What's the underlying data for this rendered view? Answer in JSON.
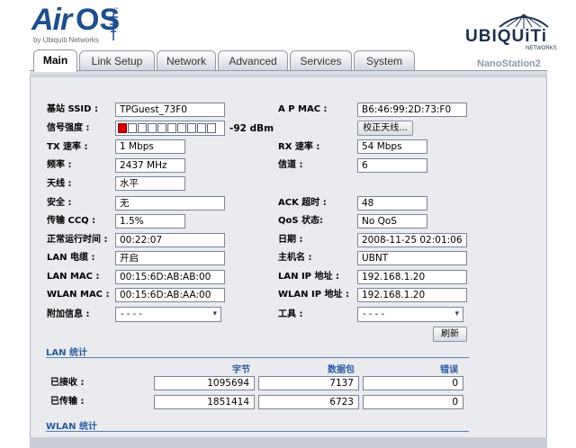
{
  "header": {
    "logo_air": "Air",
    "logo_os": "OS",
    "logo_tm": "™",
    "logo_sub": "by Ubiquiti Networks",
    "brand": "UBIQUiTi",
    "brand_sub": "NETWORKS",
    "model": "NanoStation2"
  },
  "tabs": [
    {
      "label": "Main",
      "active": true
    },
    {
      "label": "Link Setup",
      "active": false
    },
    {
      "label": "Network",
      "active": false
    },
    {
      "label": "Advanced",
      "active": false
    },
    {
      "label": "Services",
      "active": false
    },
    {
      "label": "System",
      "active": false
    }
  ],
  "status": {
    "ssid_label": "基站 SSID :",
    "ssid": "TPGuest_73F0",
    "apmac_label": "A P MAC :",
    "apmac": "B6:46:99:2D:73:F0",
    "signal_label": "信号强度 :",
    "signal_dbm": "-92 dBm",
    "signal_level": 1,
    "signal_cells": 10,
    "align_button": "校正天线...",
    "tx_label": "TX 速率 :",
    "tx": "1 Mbps",
    "rx_label": "RX 速率 :",
    "rx": "54 Mbps",
    "freq_label": "频率 :",
    "freq": "2437 MHz",
    "channel_label": "信道 :",
    "channel": "6",
    "antenna_label": "天线 :",
    "antenna": "水平",
    "security_label": "安全 :",
    "security": "无",
    "ack_label": "ACK 超时 :",
    "ack": "48",
    "ccq_label": "传输 CCQ :",
    "ccq": "1.5%",
    "qos_label": "QoS 状态:",
    "qos": "No QoS",
    "uptime_label": "正常运行时间 :",
    "uptime": "00:22:07",
    "date_label": "日期 :",
    "date": "2008-11-25 02:01:06",
    "lancable_label": "LAN 电缆 :",
    "lancable": "开启",
    "hostname_label": "主机名 :",
    "hostname": "UBNT",
    "lanmac_label": "LAN MAC :",
    "lanmac": "00:15:6D:AB:AB:00",
    "lanip_label": "LAN IP 地址 :",
    "lanip": "192.168.1.20",
    "wlanmac_label": "WLAN MAC :",
    "wlanmac": "00:15:6D:AB:AA:00",
    "wlanip_label": "WLAN IP 地址 :",
    "wlanip": "192.168.1.20",
    "extra_label": "附加信息 :",
    "extra_value": "- - - -",
    "tools_label": "工具 :",
    "tools_value": "- - - -",
    "refresh_button": "刷新"
  },
  "lan_stats": {
    "title": "LAN 统计",
    "col_bytes": "字节",
    "col_packets": "数据包",
    "col_errors": "错误",
    "rx_label": "已接收 :",
    "tx_label": "已传输 :",
    "rx_bytes": "1095694",
    "rx_packets": "7137",
    "rx_errors": "0",
    "tx_bytes": "1851414",
    "tx_packets": "6723",
    "tx_errors": "0"
  },
  "wlan_stats": {
    "title": "WLAN 统计"
  },
  "colors": {
    "brand_blue": "#1e4e8c",
    "section_blue": "#2a5aa0",
    "panel_bg": "#e9ebef",
    "signal_on": "#d40000"
  }
}
